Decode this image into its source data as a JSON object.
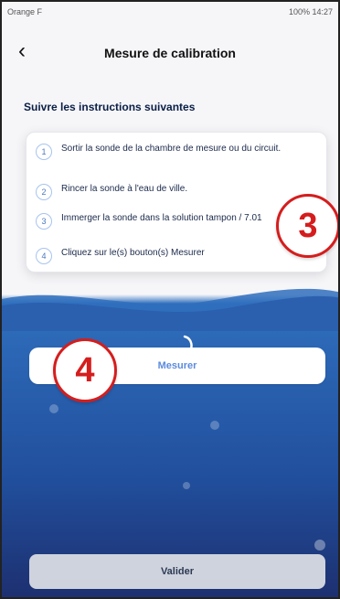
{
  "status_bar": {
    "carrier": "Orange F",
    "right": "100% 14:27"
  },
  "header": {
    "title": "Mesure de calibration"
  },
  "instructions": {
    "heading": "Suivre les instructions suivantes",
    "steps": [
      {
        "num": "1",
        "text": "Sortir la sonde de la chambre de mesure ou du circuit."
      },
      {
        "num": "2",
        "text": "Rincer la sonde à l'eau de ville."
      },
      {
        "num": "3",
        "text": "Immerger la sonde dans la solution tampon / 7.01"
      },
      {
        "num": "4",
        "text": "Cliquez sur le(s) bouton(s) Mesurer"
      }
    ]
  },
  "actions": {
    "measure_label": "Mesurer",
    "validate_label": "Valider"
  },
  "annotations": {
    "badge_three": "3",
    "badge_four": "4"
  },
  "colors": {
    "accent_blue": "#5b8bdc",
    "annotation_red": "#d51d1d",
    "background_top": "#f6f6f9",
    "water_blue": "#2f6fbd",
    "deep_blue": "#1d2f6f"
  }
}
